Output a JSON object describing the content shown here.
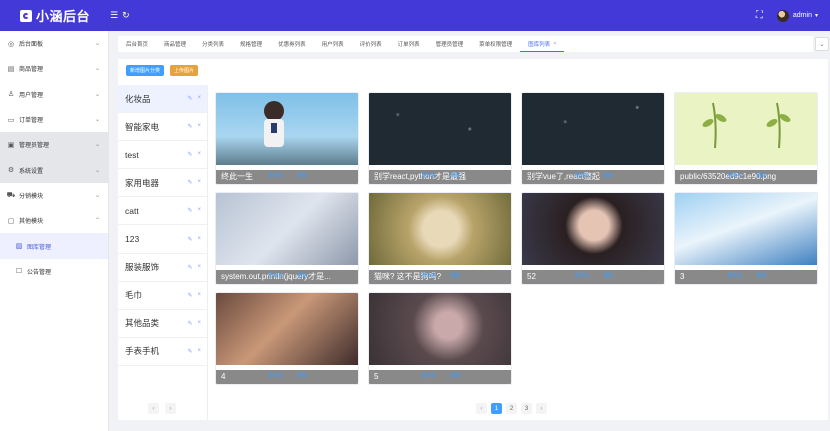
{
  "app": {
    "title": "小涵后台"
  },
  "header": {
    "user": "admin"
  },
  "sidebar": {
    "items": [
      {
        "label": "后台面板",
        "icon": "dashboard-icon",
        "arrow": "⌄"
      },
      {
        "label": "商品管理",
        "icon": "goods-icon",
        "arrow": "⌄"
      },
      {
        "label": "用户管理",
        "icon": "user-icon",
        "arrow": "⌄"
      },
      {
        "label": "订单管理",
        "icon": "order-icon",
        "arrow": "⌄"
      },
      {
        "label": "管理员管理",
        "icon": "admin-icon",
        "arrow": "⌄"
      },
      {
        "label": "系统设置",
        "icon": "settings-icon",
        "arrow": "⌄"
      },
      {
        "label": "分销模块",
        "icon": "cart-icon",
        "arrow": "⌄"
      },
      {
        "label": "其他模块",
        "icon": "other-icon",
        "arrow": "⌃"
      }
    ],
    "subitems": [
      {
        "label": "图库管理",
        "icon": "image-icon"
      },
      {
        "label": "公告管理",
        "icon": "notice-icon"
      }
    ]
  },
  "tabs": [
    "后台首页",
    "商品管理",
    "分类列表",
    "规格管理",
    "优惠券列表",
    "用户列表",
    "评价列表",
    "订单列表",
    "管理员管理",
    "菜单权限管理",
    "图库列表"
  ],
  "toolbar": {
    "new_category": "新增图片分类",
    "upload": "上传图片"
  },
  "categories": [
    "化妆品",
    "智能家电",
    "test",
    "家用电器",
    "catt",
    "123",
    "服装服饰",
    "毛巾",
    "其他品类",
    "手表手机"
  ],
  "category_ops": {
    "edit": "✎",
    "delete": "×"
  },
  "images": [
    {
      "caption": "终此一生"
    },
    {
      "caption": "别学react,python才是最强"
    },
    {
      "caption": "别学vue了,react整起"
    },
    {
      "caption": "public/63520ed9c1e90.png"
    },
    {
      "caption": "system.out.println(jquery才是..."
    },
    {
      "caption": "猫咪? 这不是狗吗?"
    },
    {
      "caption": "52"
    },
    {
      "caption": "3"
    },
    {
      "caption": "4"
    },
    {
      "caption": "5"
    }
  ],
  "image_ops": {
    "rename": "重命名",
    "delete": "删除"
  },
  "pager": {
    "prev": "‹",
    "next": "›",
    "pages": [
      "1",
      "2",
      "3"
    ],
    "current": "1"
  },
  "colors": {
    "header": "#4338d8",
    "primary": "#409eff",
    "warning": "#e6a23c"
  }
}
